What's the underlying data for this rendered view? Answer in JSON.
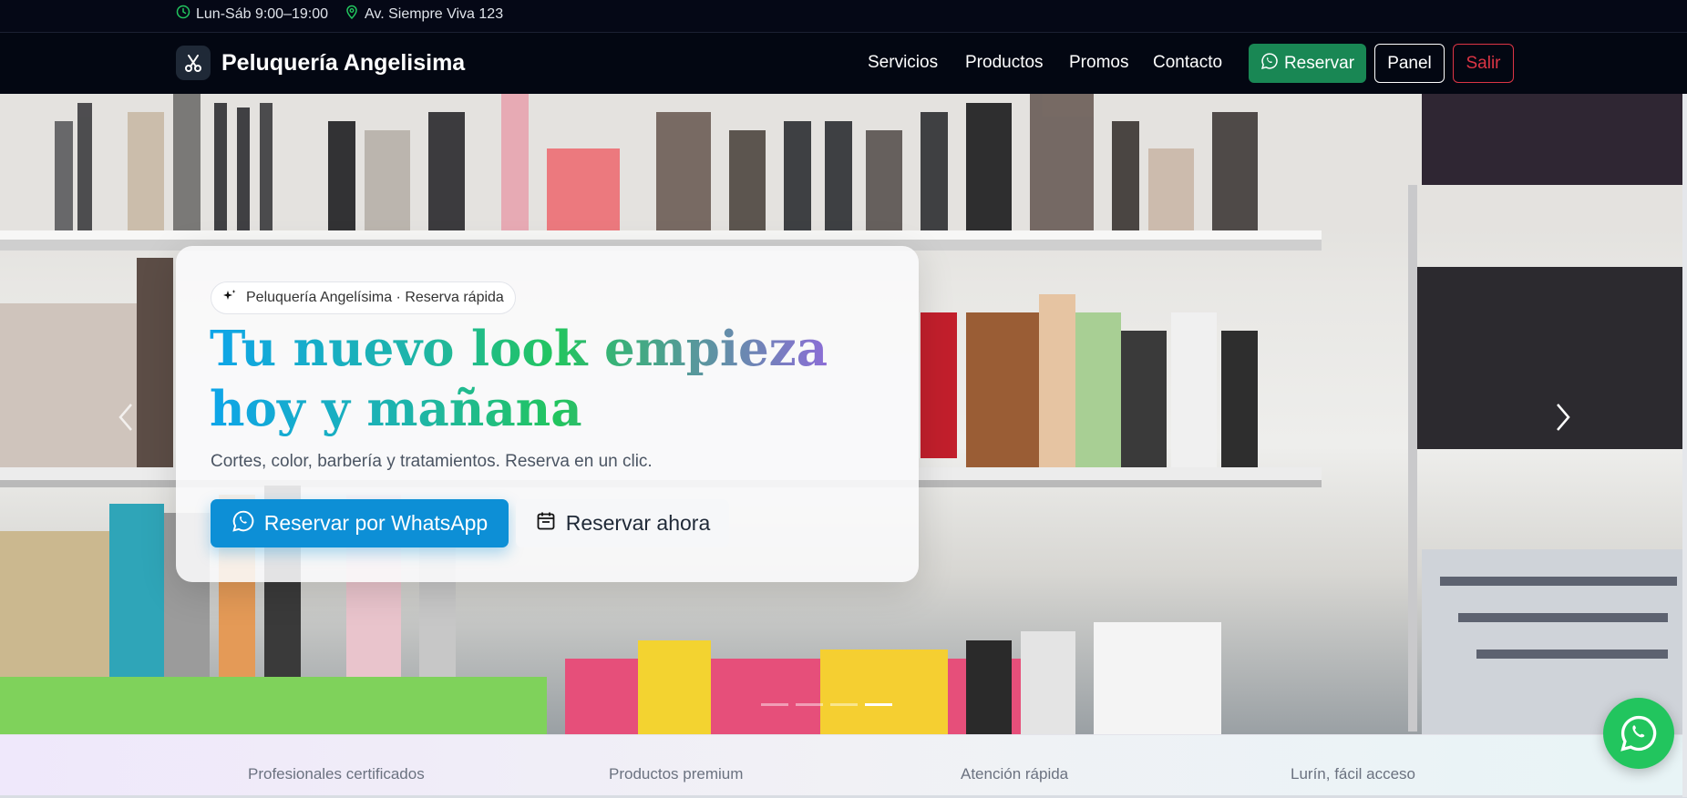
{
  "topbar": {
    "hours": "Lun-Sáb 9:00–19:00",
    "address": "Av. Siempre Viva 123",
    "icons": [
      "clock-icon",
      "map-pin-icon"
    ],
    "icon_color": "#22c55e"
  },
  "navbar": {
    "brand": "Peluquería Angelisima",
    "brand_icon": "scissors-icon",
    "links": [
      "Servicios",
      "Productos",
      "Promos",
      "Contacto"
    ],
    "reserve_label": "Reservar",
    "panel_label": "Panel",
    "exit_label": "Salir"
  },
  "hero": {
    "badge": "Peluquería Angelísima · Reserva rápida",
    "badge_icon": "sparkles-icon",
    "title": "Tu nuevo look empieza hoy y mañana",
    "subtitle": "Cortes, color, barbería y tratamientos. Reserva en un clic.",
    "primary_cta": "Reservar por WhatsApp",
    "primary_icon": "whatsapp-icon",
    "secondary_cta": "Reservar ahora",
    "secondary_icon": "calendar-icon",
    "slide_count": 4,
    "active_slide": 4
  },
  "features": [
    "Profesionales certificados",
    "Productos premium",
    "Atención rápida",
    "Lurín, fácil acceso"
  ],
  "colors": {
    "success": "#198754",
    "danger": "#dc3545",
    "primary": "#0d8fd6",
    "whatsapp": "#22c55e",
    "dark": "#030712"
  }
}
